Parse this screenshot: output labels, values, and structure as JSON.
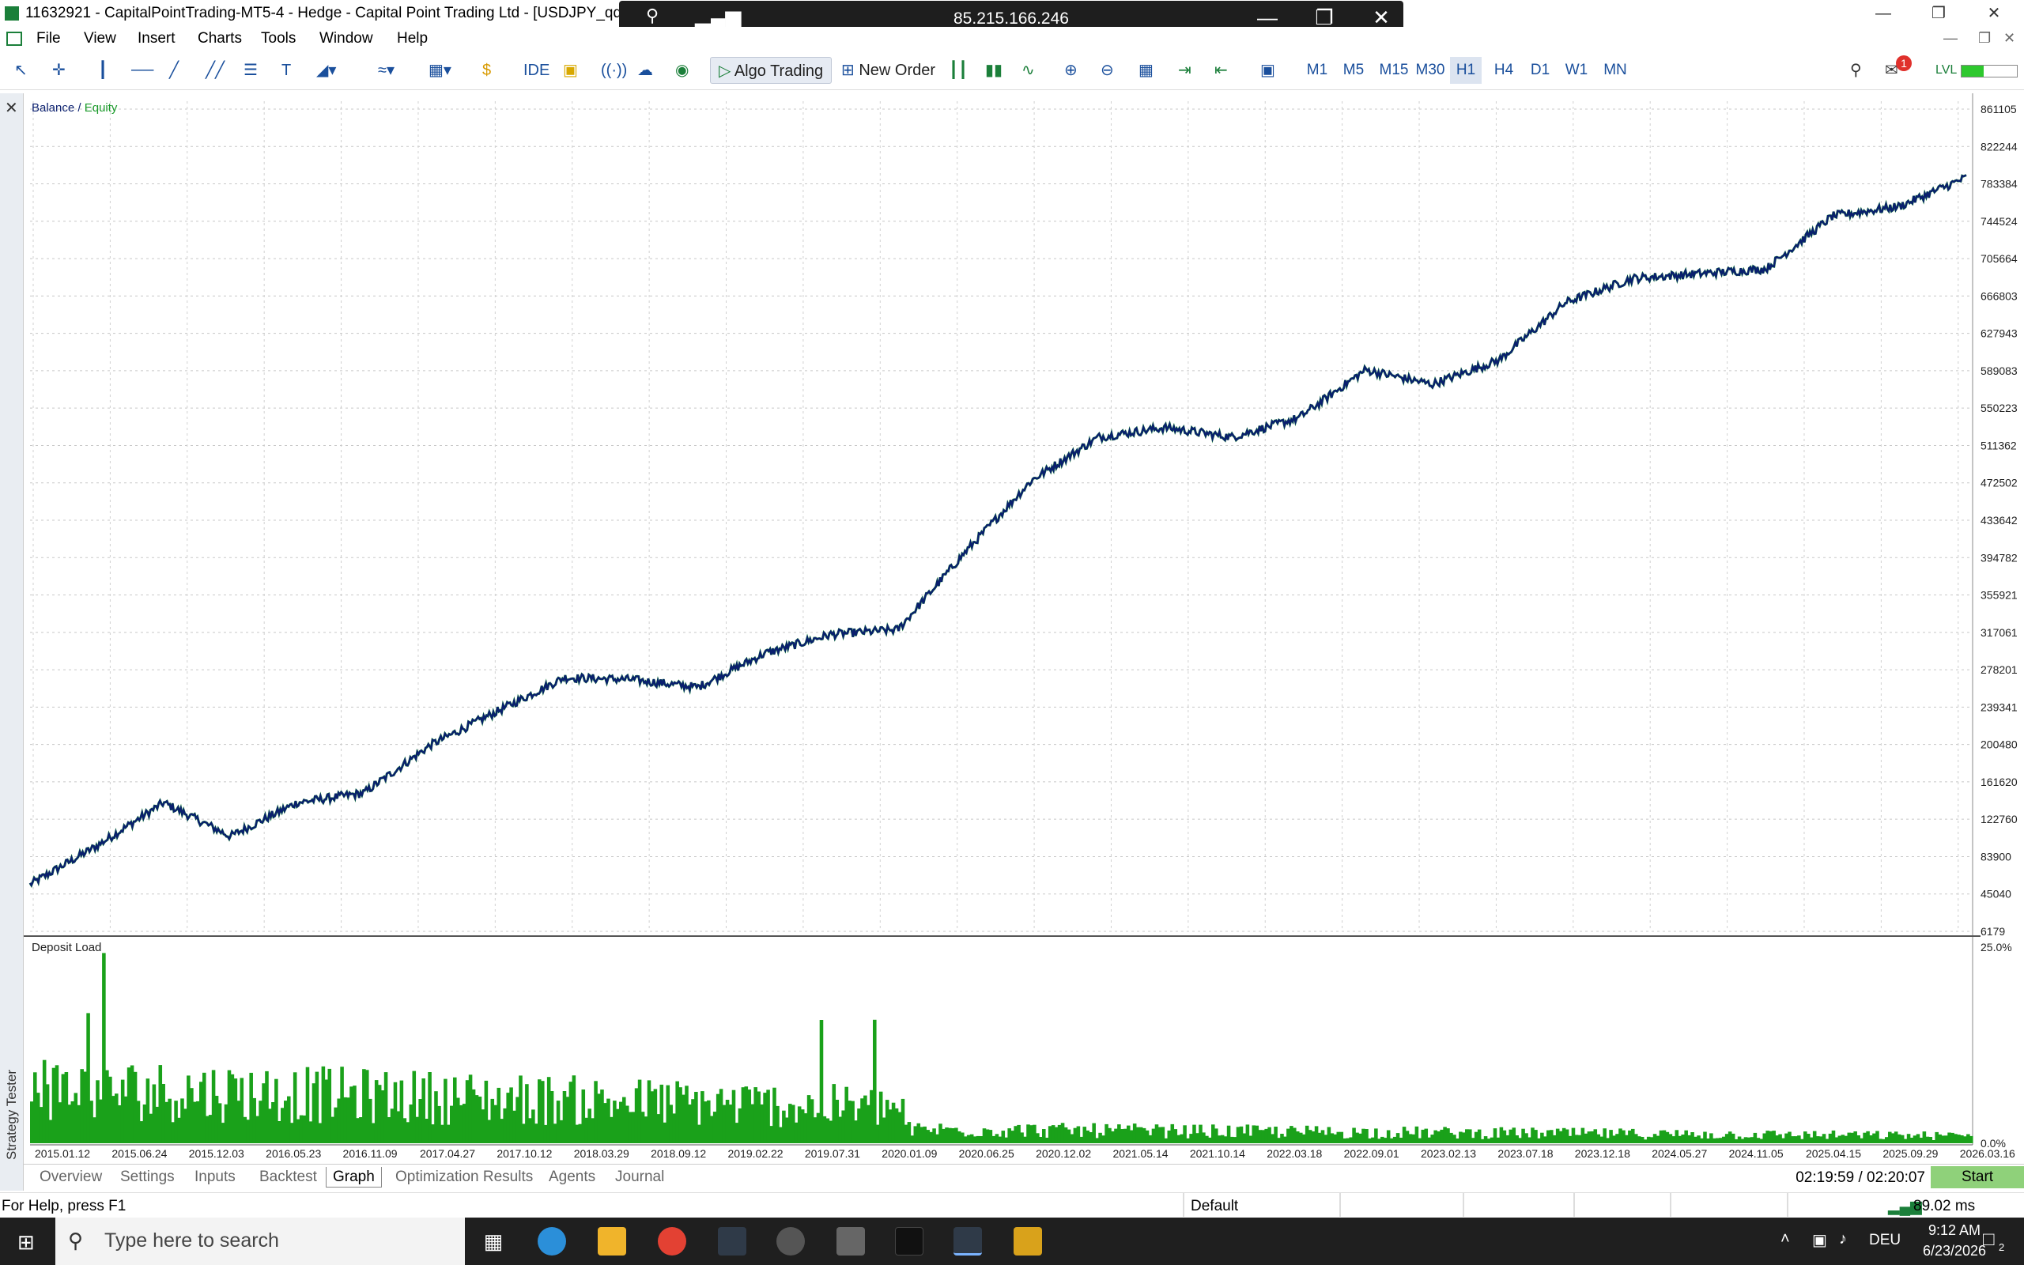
{
  "window": {
    "title": "11632921 - CapitalPointTrading-MT5-4 - Hedge - Capital Point Trading Ltd - [USDJPY_qdm,H1]",
    "remote_ip": "85.215.166.246"
  },
  "menu": [
    "File",
    "View",
    "Insert",
    "Charts",
    "Tools",
    "Window",
    "Help"
  ],
  "toolbar": {
    "ide": "IDE",
    "algo_trading": "Algo Trading",
    "new_order": "New Order",
    "timeframes": [
      "M1",
      "M5",
      "M15",
      "M30",
      "H1",
      "H4",
      "D1",
      "W1",
      "MN"
    ],
    "active_timeframe": "H1",
    "notification_count": "1"
  },
  "chart_data": [
    {
      "type": "line",
      "title": "Balance / Equity",
      "legend": [
        "Balance",
        "Equity"
      ],
      "x": [
        "2015.01.12",
        "2015.06.24",
        "2015.12.03",
        "2016.05.23",
        "2016.11.09",
        "2017.04.27",
        "2017.10.12",
        "2018.03.29",
        "2018.09.12",
        "2019.02.22",
        "2019.07.31",
        "2020.01.09",
        "2020.06.25",
        "2020.12.02",
        "2021.05.14",
        "2021.10.14",
        "2022.03.18",
        "2022.09.01",
        "2023.02.13",
        "2023.07.18",
        "2023.12.18",
        "2024.05.27",
        "2024.11.05",
        "2025.04.15",
        "2025.09.29",
        "2026.03.16"
      ],
      "y_ticks": [
        861105,
        822244,
        783384,
        744524,
        705664,
        666803,
        627943,
        589083,
        550223,
        511362,
        472502,
        433642,
        394782,
        355921,
        317061,
        278201,
        239341,
        200480,
        161620,
        122760,
        83900,
        45040,
        6179
      ],
      "ylim": [
        6179,
        861105
      ],
      "series": [
        {
          "name": "Balance",
          "color": "#0a1f6e",
          "values": [
            55000,
            95000,
            140000,
            105000,
            140000,
            150000,
            200000,
            235000,
            270000,
            268000,
            260000,
            295000,
            315000,
            320000,
            400000,
            475000,
            520000,
            530000,
            520000,
            540000,
            590000,
            575000,
            600000,
            660000,
            685000,
            690000,
            695000,
            750000,
            760000,
            790000
          ]
        },
        {
          "name": "Equity",
          "color": "#1a9a2a"
        }
      ],
      "grid": true
    },
    {
      "type": "bar",
      "title": "Deposit Load",
      "y_ticks": [
        "25.0%",
        "0.0%"
      ],
      "ylim": [
        0,
        25
      ],
      "color": "#1aa11a"
    }
  ],
  "tabs": [
    "Overview",
    "Settings",
    "Inputs",
    "Backtest",
    "Graph",
    "Optimization Results",
    "Agents",
    "Journal"
  ],
  "active_tab": "Graph",
  "side_label": "Strategy Tester",
  "timer": "02:19:59 / 02:20:07",
  "start_label": "Start",
  "status": {
    "help": "For Help, press F1",
    "profile": "Default",
    "ping": "89.02 ms"
  },
  "taskbar": {
    "search_placeholder": "Type here to search",
    "language": "DEU",
    "time": "9:12 AM",
    "date": "6/23/2026",
    "notifications": "2"
  }
}
